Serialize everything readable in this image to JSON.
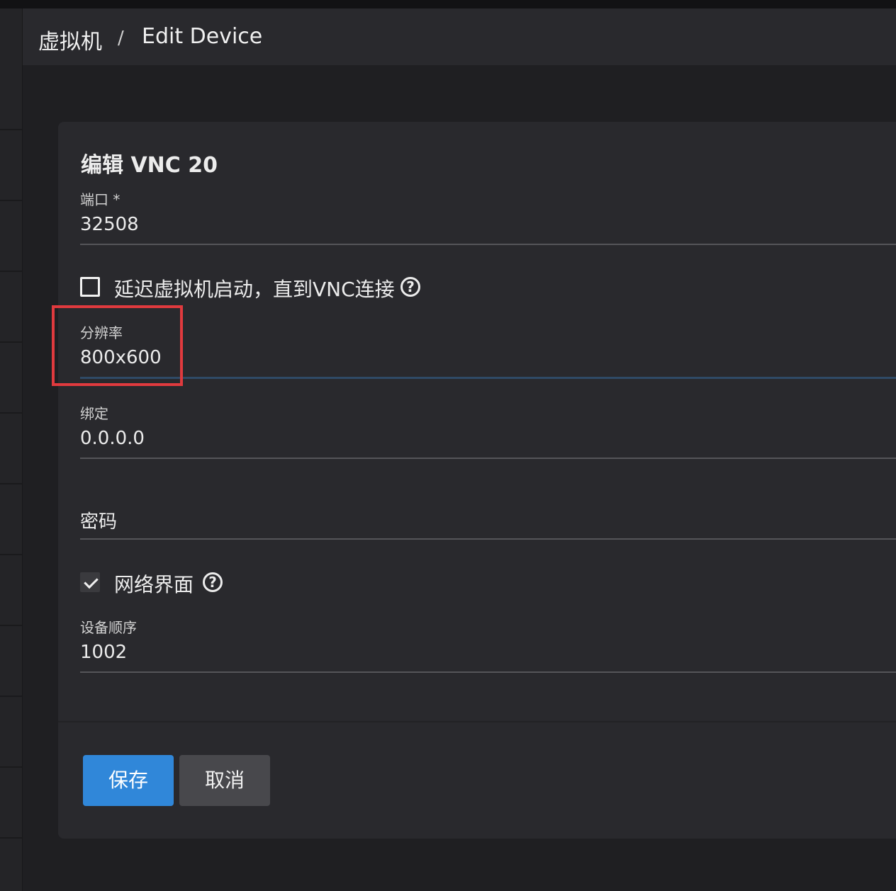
{
  "breadcrumb": {
    "root": "虚拟机",
    "separator": "/",
    "current": "Edit Device"
  },
  "form": {
    "title": "编辑 VNC 20",
    "port": {
      "label": "端口 *",
      "value": "32508"
    },
    "delay_checkbox": {
      "label": "延迟虚拟机启动，直到VNC连接",
      "checked": false
    },
    "resolution": {
      "label": "分辨率",
      "value": "800x600"
    },
    "bind": {
      "label": "绑定",
      "value": "0.0.0.0"
    },
    "password": {
      "placeholder": "密码",
      "value": ""
    },
    "web_interface_checkbox": {
      "label": "网络界面",
      "checked": true
    },
    "device_order": {
      "label": "设备顺序",
      "value": "1002"
    }
  },
  "buttons": {
    "save": "保存",
    "cancel": "取消"
  },
  "help_glyph": "?",
  "colors": {
    "primary": "#3087d9",
    "highlight": "#e03a3e",
    "background": "#1e1e21",
    "card": "#29292d"
  }
}
